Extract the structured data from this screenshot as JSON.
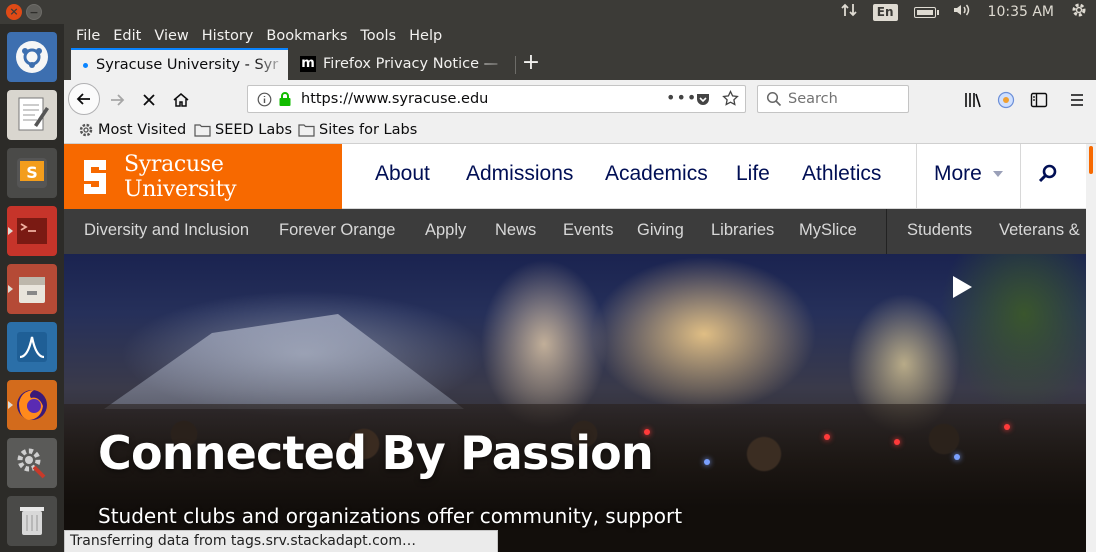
{
  "system_panel": {
    "language": "En",
    "clock": "10:35 AM"
  },
  "launcher": {
    "items": [
      "ubuntu-icon",
      "text-editor-icon",
      "sublime-icon",
      "terminal-icon",
      "file-manager-icon",
      "wireshark-icon",
      "firefox-icon",
      "settings-icon",
      "trash-icon"
    ]
  },
  "menubar": {
    "items": [
      "File",
      "Edit",
      "View",
      "History",
      "Bookmarks",
      "Tools",
      "Help"
    ]
  },
  "tabs": [
    {
      "label": "Syracuse University - Syr"
    },
    {
      "label": "Firefox Privacy Notice —"
    }
  ],
  "urlbar": {
    "url": "https://www.syracuse.edu"
  },
  "searchbar": {
    "placeholder": "Search"
  },
  "bookmarks": [
    "Most Visited",
    "SEED Labs",
    "Sites for Labs"
  ],
  "site": {
    "logo_text": "Syracuse University",
    "main_nav": [
      "About",
      "Admissions",
      "Academics",
      "Life",
      "Athletics"
    ],
    "more_label": "More",
    "sub_nav": [
      "Diversity and Inclusion",
      "Forever Orange",
      "Apply",
      "News",
      "Events",
      "Giving",
      "Libraries",
      "MySlice",
      "Students",
      "Veterans &"
    ],
    "hero_title": "Connected By Passion",
    "hero_subtitle": "Student clubs and organizations offer community, support",
    "colors": {
      "orange": "#f76900",
      "navy": "#000e54",
      "subnav_bg": "#3c3c3c"
    }
  },
  "status": "Transferring data from tags.srv.stackadapt.com…"
}
